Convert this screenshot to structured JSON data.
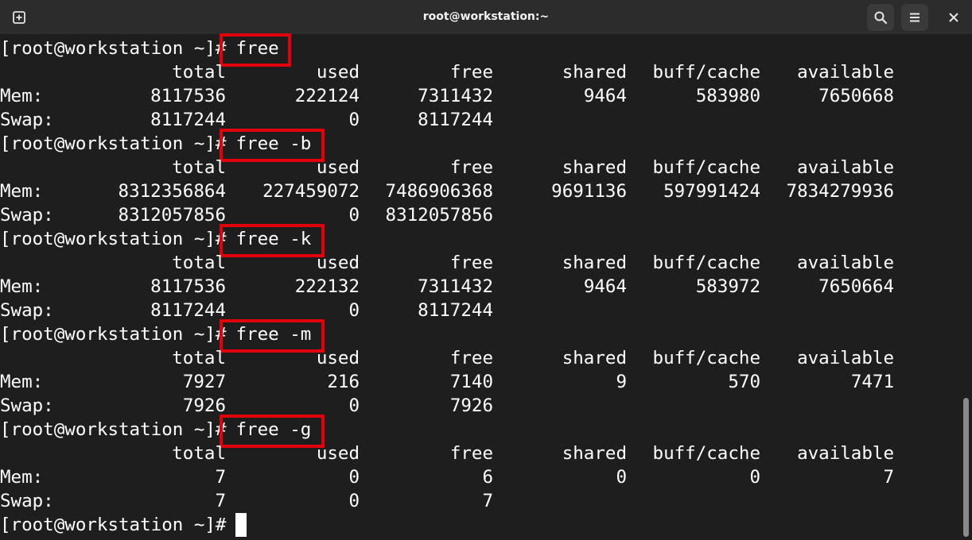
{
  "window": {
    "title": "root@workstation:~"
  },
  "icons": {
    "new_tab": "new-tab-icon",
    "search": "search-icon",
    "menu": "hamburger-menu-icon",
    "close": "close-icon"
  },
  "colors": {
    "background": "#1e1e1e",
    "titlebar": "#2c2c2c",
    "highlight_box": "#e1000b",
    "text": "#ffffff"
  },
  "terminal": {
    "prompt": "[root@workstation ~]#",
    "headers": [
      "total",
      "used",
      "free",
      "shared",
      "buff/cache",
      "available"
    ],
    "blocks": [
      {
        "command": "free",
        "mem": [
          "Mem:",
          "8117536",
          "222124",
          "7311432",
          "9464",
          "583980",
          "7650668"
        ],
        "swap": [
          "Swap:",
          "8117244",
          "0",
          "8117244"
        ]
      },
      {
        "command": "free -b",
        "mem": [
          "Mem:",
          "8312356864",
          "227459072",
          "7486906368",
          "9691136",
          "597991424",
          "7834279936"
        ],
        "swap": [
          "Swap:",
          "8312057856",
          "0",
          "8312057856"
        ]
      },
      {
        "command": "free -k",
        "mem": [
          "Mem:",
          "8117536",
          "222132",
          "7311432",
          "9464",
          "583972",
          "7650664"
        ],
        "swap": [
          "Swap:",
          "8117244",
          "0",
          "8117244"
        ]
      },
      {
        "command": "free -m",
        "mem": [
          "Mem:",
          "7927",
          "216",
          "7140",
          "9",
          "570",
          "7471"
        ],
        "swap": [
          "Swap:",
          "7926",
          "0",
          "7926"
        ]
      },
      {
        "command": "free -g",
        "mem": [
          "Mem:",
          "7",
          "0",
          "6",
          "0",
          "0",
          "7"
        ],
        "swap": [
          "Swap:",
          "7",
          "0",
          "7"
        ]
      }
    ]
  }
}
